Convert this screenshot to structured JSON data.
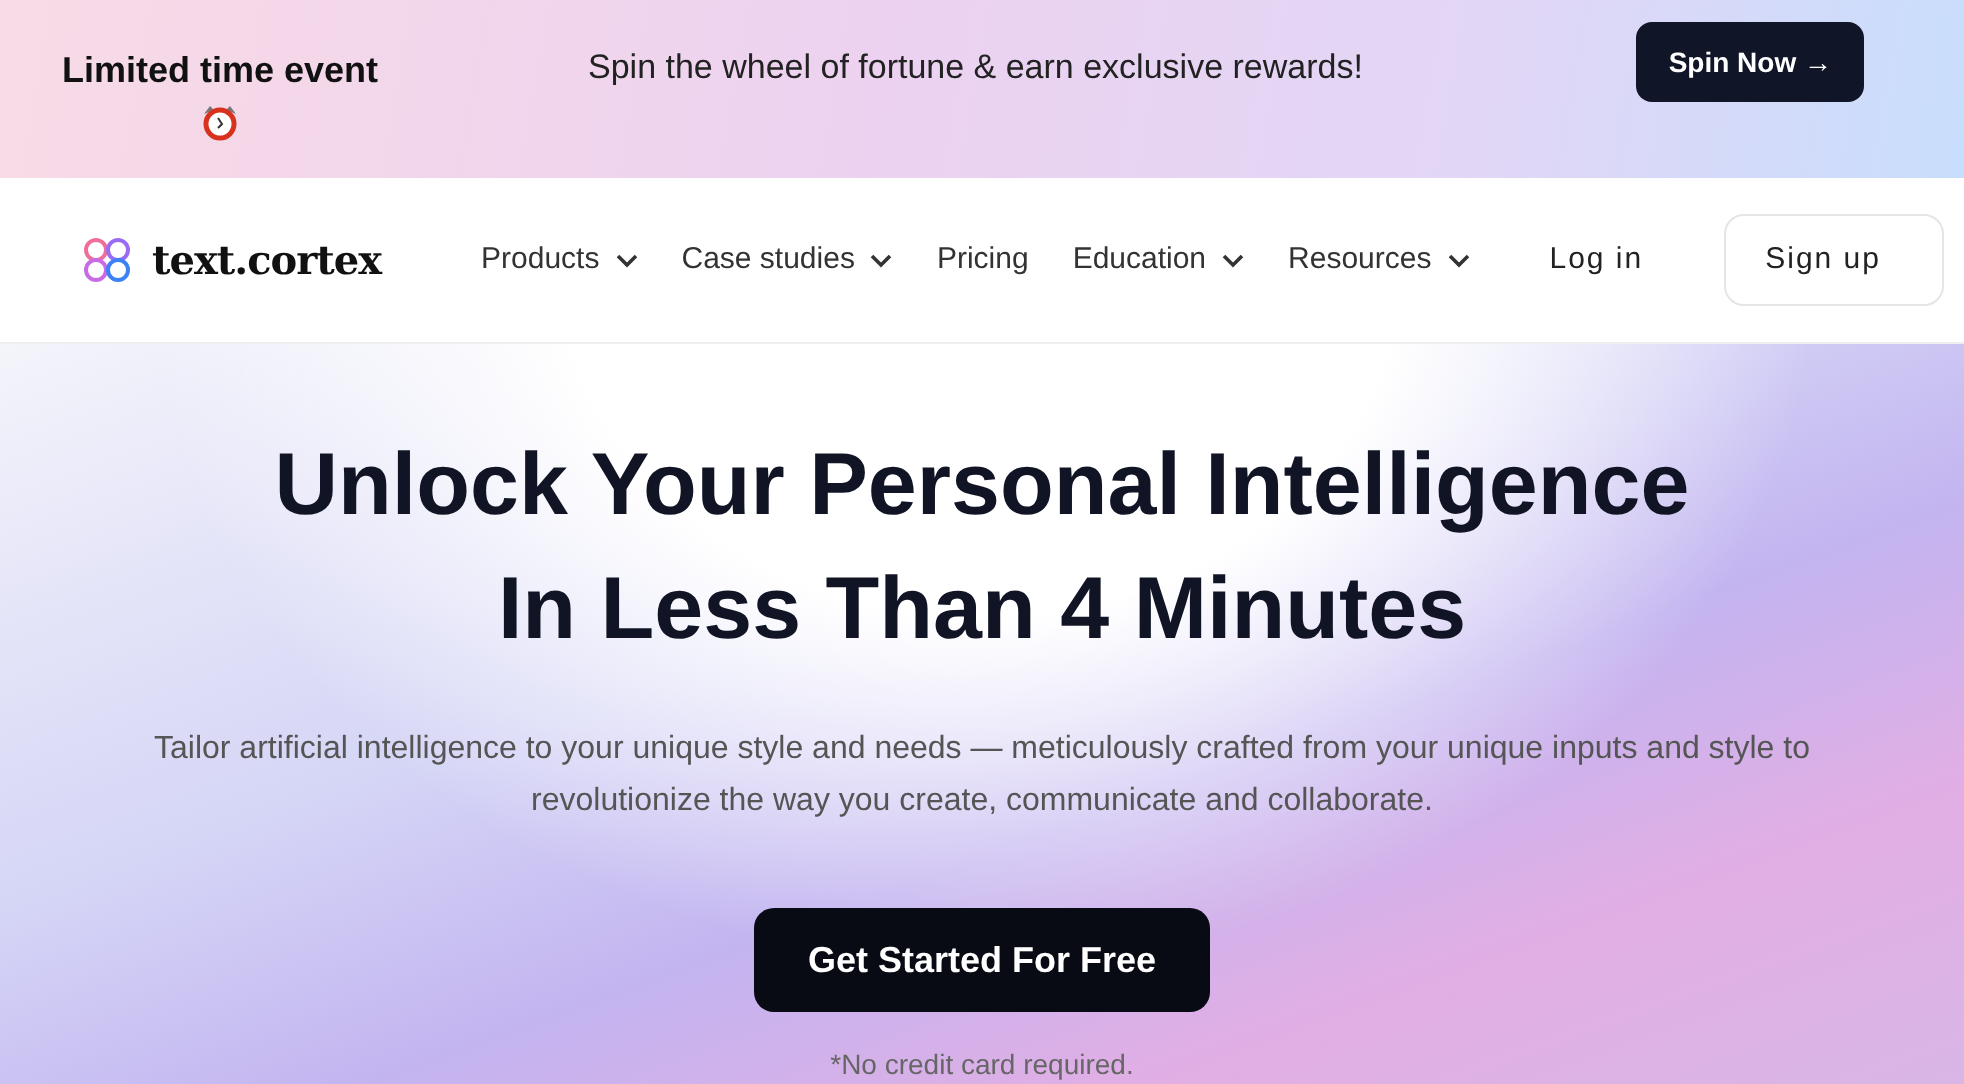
{
  "banner": {
    "title": "Limited time event",
    "message": "Spin the wheel of fortune & earn exclusive rewards!",
    "button": "Spin Now →"
  },
  "nav": {
    "logo": "text.cortex",
    "items": [
      {
        "label": "Products",
        "kind": "dropdown"
      },
      {
        "label": "Case studies",
        "kind": "dropdown"
      },
      {
        "label": "Pricing",
        "kind": "link"
      },
      {
        "label": "Education",
        "kind": "dropdown"
      },
      {
        "label": "Resources",
        "kind": "dropdown"
      }
    ],
    "login": "Log in",
    "signup": "Sign up"
  },
  "hero": {
    "headline_lines": [
      "Unlock Your Personal Intelligence",
      "In Less Than 4 Minutes"
    ],
    "subtitle": "Tailor artificial intelligence to your unique style and needs — meticulously crafted from your unique inputs and style to revolutionize the way you create, communicate and collaborate.",
    "button": "Get Started For Free",
    "note": "*No credit card required."
  }
}
